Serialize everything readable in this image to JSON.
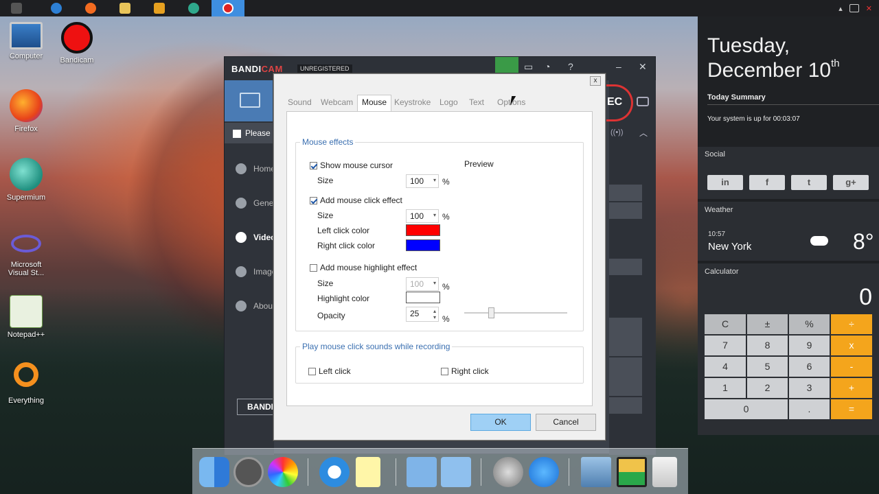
{
  "taskbar": {
    "apps": [
      "windows-explorer",
      "internet-explorer",
      "firefox",
      "file-explorer",
      "media-player",
      "supermium",
      "bandicam"
    ]
  },
  "desktop": {
    "icons": [
      {
        "label": "Computer"
      },
      {
        "label": "Bandicam"
      },
      {
        "label": "Firefox"
      },
      {
        "label": "Supermium"
      },
      {
        "label": "Microsoft Visual St..."
      },
      {
        "label": "Notepad++"
      },
      {
        "label": "Everything"
      }
    ]
  },
  "bandicam": {
    "logo_prefix": "BANDI",
    "logo_suffix": "CAM",
    "unregistered": "UNREGISTERED",
    "please": "Please",
    "nav": [
      "Home",
      "General",
      "Video",
      "Image",
      "About"
    ],
    "bandi_button": "BANDI",
    "rec": "EC",
    "colors": {
      "accent": "#4a7bb4",
      "rec": "#d33333",
      "lock": "#3a9a47"
    }
  },
  "dialog": {
    "close": "x",
    "tabs": [
      "Sound",
      "Webcam",
      "Mouse",
      "Keystroke",
      "Logo",
      "Text",
      "Options"
    ],
    "active_tab": "Mouse",
    "mouse_effects": {
      "title": "Mouse effects",
      "preview": "Preview",
      "show_cursor": {
        "label": "Show mouse cursor",
        "checked": true,
        "size_label": "Size",
        "size": "100",
        "unit": "%"
      },
      "click_effect": {
        "label": "Add mouse click effect",
        "checked": true,
        "size_label": "Size",
        "size": "100",
        "unit": "%",
        "left_label": "Left click color",
        "left_color": "#ff0000",
        "right_label": "Right click color",
        "right_color": "#0000ff"
      },
      "highlight": {
        "label": "Add mouse highlight effect",
        "checked": false,
        "size_label": "Size",
        "size": "100",
        "unit": "%",
        "color_label": "Highlight color",
        "color": "#ffffff",
        "opacity_label": "Opacity",
        "opacity": "25",
        "opacity_unit": "%"
      }
    },
    "sounds": {
      "title": "Play mouse click sounds while recording",
      "left": {
        "label": "Left click",
        "checked": false
      },
      "right": {
        "label": "Right click",
        "checked": false
      }
    },
    "ok": "OK",
    "cancel": "Cancel"
  },
  "widgets": {
    "day": "Tuesday,",
    "date": "December 10",
    "date_suffix": "th",
    "summary_title": "Today Summary",
    "uptime": "Your system is up for 00:03:07",
    "social_title": "Social",
    "social": [
      "in",
      "f",
      "t",
      "g+"
    ],
    "weather_title": "Weather",
    "weather_time": "10:57",
    "weather_city": "New York",
    "weather_temp": "8°",
    "calculator_title": "Calculator",
    "calc_display": "0",
    "calc_keys": [
      [
        "C",
        "±",
        "%",
        "÷"
      ],
      [
        "7",
        "8",
        "9",
        "x"
      ],
      [
        "4",
        "5",
        "6",
        "-"
      ],
      [
        "1",
        "2",
        "3",
        "+"
      ],
      [
        "0",
        ".",
        "="
      ]
    ]
  }
}
